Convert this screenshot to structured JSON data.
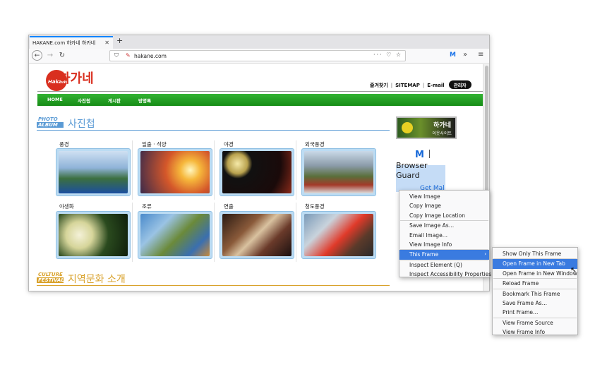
{
  "browser": {
    "tab_title": "HAKANE.com 하카네 하카네",
    "tab_close": "✕",
    "new_tab": "+",
    "url": "hakane.com",
    "url_actions": "··· ♡ ☆",
    "back": "←",
    "forward": "→",
    "reload": "↻",
    "ext_icon": "M",
    "overflow": "»",
    "menu": "≡"
  },
  "site": {
    "logo_en": "Hakane",
    "logo_kr": "하가네",
    "topnav": {
      "item1": "즐겨찾기",
      "sitemap": "SITEMAP",
      "email": "E-mail",
      "admin": "관리자"
    },
    "greennav": [
      "HOME",
      "사진첩",
      "게시판",
      "방명록"
    ],
    "photo_album": {
      "en_top": "PHOTO",
      "en_bottom": "ALBUM",
      "kr": "사진첩",
      "items": [
        {
          "label": "풍경"
        },
        {
          "label": "일출 · 석양"
        },
        {
          "label": "야경"
        },
        {
          "label": "외국풍경"
        },
        {
          "label": "야생화"
        },
        {
          "label": "조류"
        },
        {
          "label": "연출"
        },
        {
          "label": "청도풍경"
        }
      ]
    },
    "culture": {
      "en_top": "CULTURE",
      "en_bottom": "FESTIVAL",
      "kr": "지역문화 소개"
    },
    "side_banner": {
      "title": "하가네",
      "subtitle": "이웃사이트"
    },
    "browser_guard": {
      "icon": "M",
      "line1": "Browser",
      "line2": "Guard",
      "get": "Get Mal"
    }
  },
  "context_menu": {
    "items": [
      "View Image",
      "Copy Image",
      "Copy Image Location",
      "Save Image As…",
      "Email Image…",
      "View Image Info",
      "This Frame",
      "Inspect Element (Q)",
      "Inspect Accessibility Properties"
    ],
    "submenu_arrow": "›",
    "submenu": [
      "Show Only This Frame",
      "Open Frame in New Tab",
      "Open Frame in New Window",
      "Reload Frame",
      "Bookmark This Frame",
      "Save Frame As…",
      "Print Frame…",
      "View Frame Source",
      "View Frame Info"
    ]
  },
  "colors": {
    "green_nav": "#1f9e1f",
    "photo_album_heading": "#5b9bd5",
    "culture_heading": "#d9a22c",
    "menu_highlight": "#3a7be0",
    "tab_accent": "#0a84ff"
  }
}
